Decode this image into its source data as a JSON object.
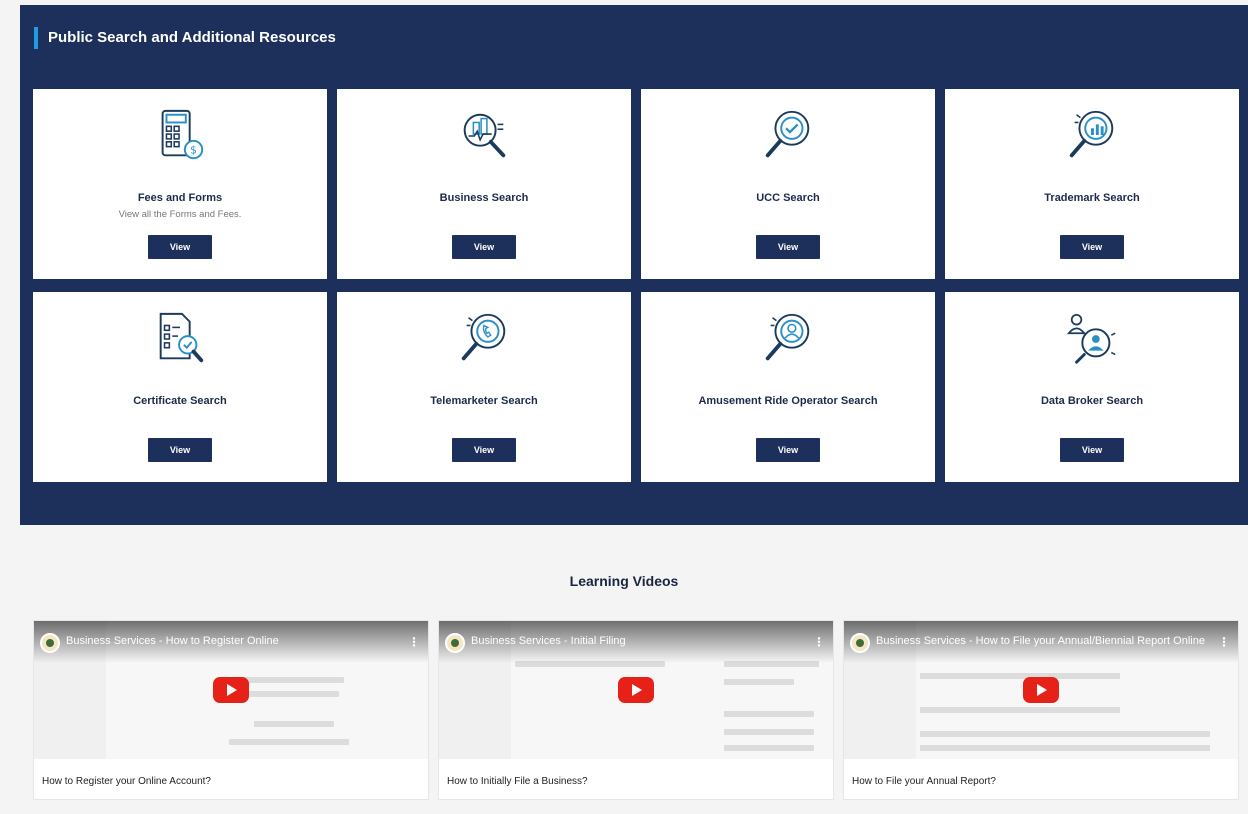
{
  "resources": {
    "heading": "Public Search and Additional Resources",
    "cards": [
      {
        "title": "Fees and Forms",
        "desc": "View all the Forms and Fees.",
        "button": "View",
        "icon": "calculator-dollar-icon"
      },
      {
        "title": "Business Search",
        "desc": "",
        "button": "View",
        "icon": "business-search-icon"
      },
      {
        "title": "UCC Search",
        "desc": "",
        "button": "View",
        "icon": "ucc-search-icon"
      },
      {
        "title": "Trademark Search",
        "desc": "",
        "button": "View",
        "icon": "trademark-search-icon"
      },
      {
        "title": "Certificate Search",
        "desc": "",
        "button": "View",
        "icon": "certificate-search-icon"
      },
      {
        "title": "Telemarketer Search",
        "desc": "",
        "button": "View",
        "icon": "telemarketer-search-icon"
      },
      {
        "title": "Amusement Ride Operator Search",
        "desc": "",
        "button": "View",
        "icon": "operator-search-icon"
      },
      {
        "title": "Data Broker Search",
        "desc": "",
        "button": "View",
        "icon": "data-broker-search-icon"
      }
    ]
  },
  "learning": {
    "heading": "Learning Videos",
    "videos": [
      {
        "title": "Business Services - How to Register Online",
        "caption": "How to Register your Online Account?"
      },
      {
        "title": "Business Services - Initial Filing",
        "caption": "How to Initially File a Business?"
      },
      {
        "title": "Business Services - How to File your Annual/Biennial Report Online",
        "caption": "How to File your Annual Report?"
      }
    ]
  },
  "colors": {
    "panel": "#1d2f5b",
    "accent": "#1f9ce3",
    "play": "#e62117",
    "icon_stroke": "#1c3a5c",
    "icon_accent": "#2a8fc5"
  }
}
